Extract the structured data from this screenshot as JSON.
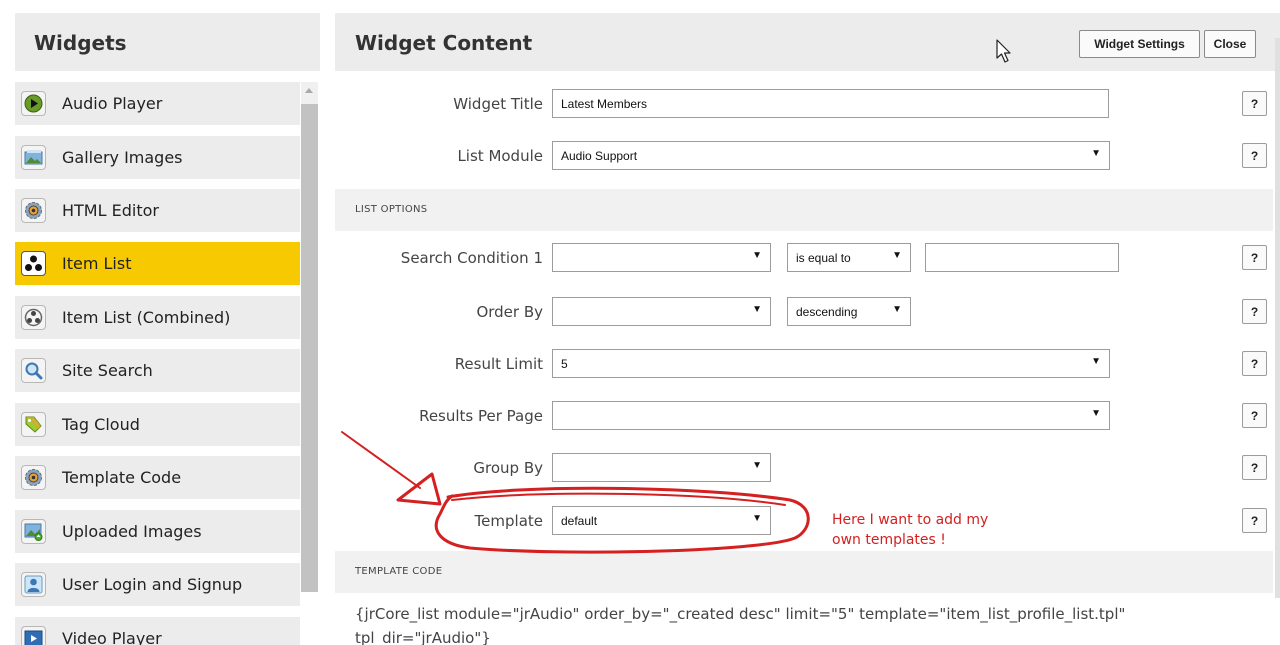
{
  "sidebar": {
    "title": "Widgets",
    "items": [
      {
        "label": "Audio Player",
        "icon": "play-icon",
        "active": false
      },
      {
        "label": "Gallery Images",
        "icon": "gallery-icon",
        "active": false
      },
      {
        "label": "HTML Editor",
        "icon": "gear-icon",
        "active": false
      },
      {
        "label": "Item List",
        "icon": "item-list-icon",
        "active": true
      },
      {
        "label": "Item List (Combined)",
        "icon": "item-list-combined-icon",
        "active": false
      },
      {
        "label": "Site Search",
        "icon": "search-icon",
        "active": false
      },
      {
        "label": "Tag Cloud",
        "icon": "tag-icon",
        "active": false
      },
      {
        "label": "Template Code",
        "icon": "gear-icon",
        "active": false
      },
      {
        "label": "Uploaded Images",
        "icon": "image-upload-icon",
        "active": false
      },
      {
        "label": "User Login and Signup",
        "icon": "user-icon",
        "active": false
      },
      {
        "label": "Video Player",
        "icon": "video-icon",
        "active": false
      }
    ]
  },
  "main": {
    "title": "Widget Content",
    "settings_button": "Widget Settings",
    "close_button": "Close",
    "help_label": "?",
    "dropdown_arrow": "▼",
    "fields": {
      "widget_title": {
        "label": "Widget Title",
        "value": "Latest Members"
      },
      "list_module": {
        "label": "List Module",
        "value": "Audio Support"
      },
      "search_condition": {
        "label": "Search Condition 1",
        "field_value": "",
        "operator": "is equal to",
        "value": ""
      },
      "order_by": {
        "label": "Order By",
        "value": "",
        "direction": "descending"
      },
      "result_limit": {
        "label": "Result Limit",
        "value": "5"
      },
      "results_per_page": {
        "label": "Results Per Page",
        "value": ""
      },
      "group_by": {
        "label": "Group By",
        "value": ""
      },
      "template": {
        "label": "Template",
        "value": "default"
      }
    },
    "list_options_heading": "LIST OPTIONS",
    "template_code_heading": "TEMPLATE CODE",
    "template_code": "{jrCore_list module=\"jrAudio\" order_by=\"_created desc\" limit=\"5\" template=\"item_list_profile_list.tpl\" tpl_dir=\"jrAudio\"}"
  },
  "annotation": {
    "note_line1": "Here I want to add my",
    "note_line2": "own templates !",
    "color": "#d42020"
  }
}
